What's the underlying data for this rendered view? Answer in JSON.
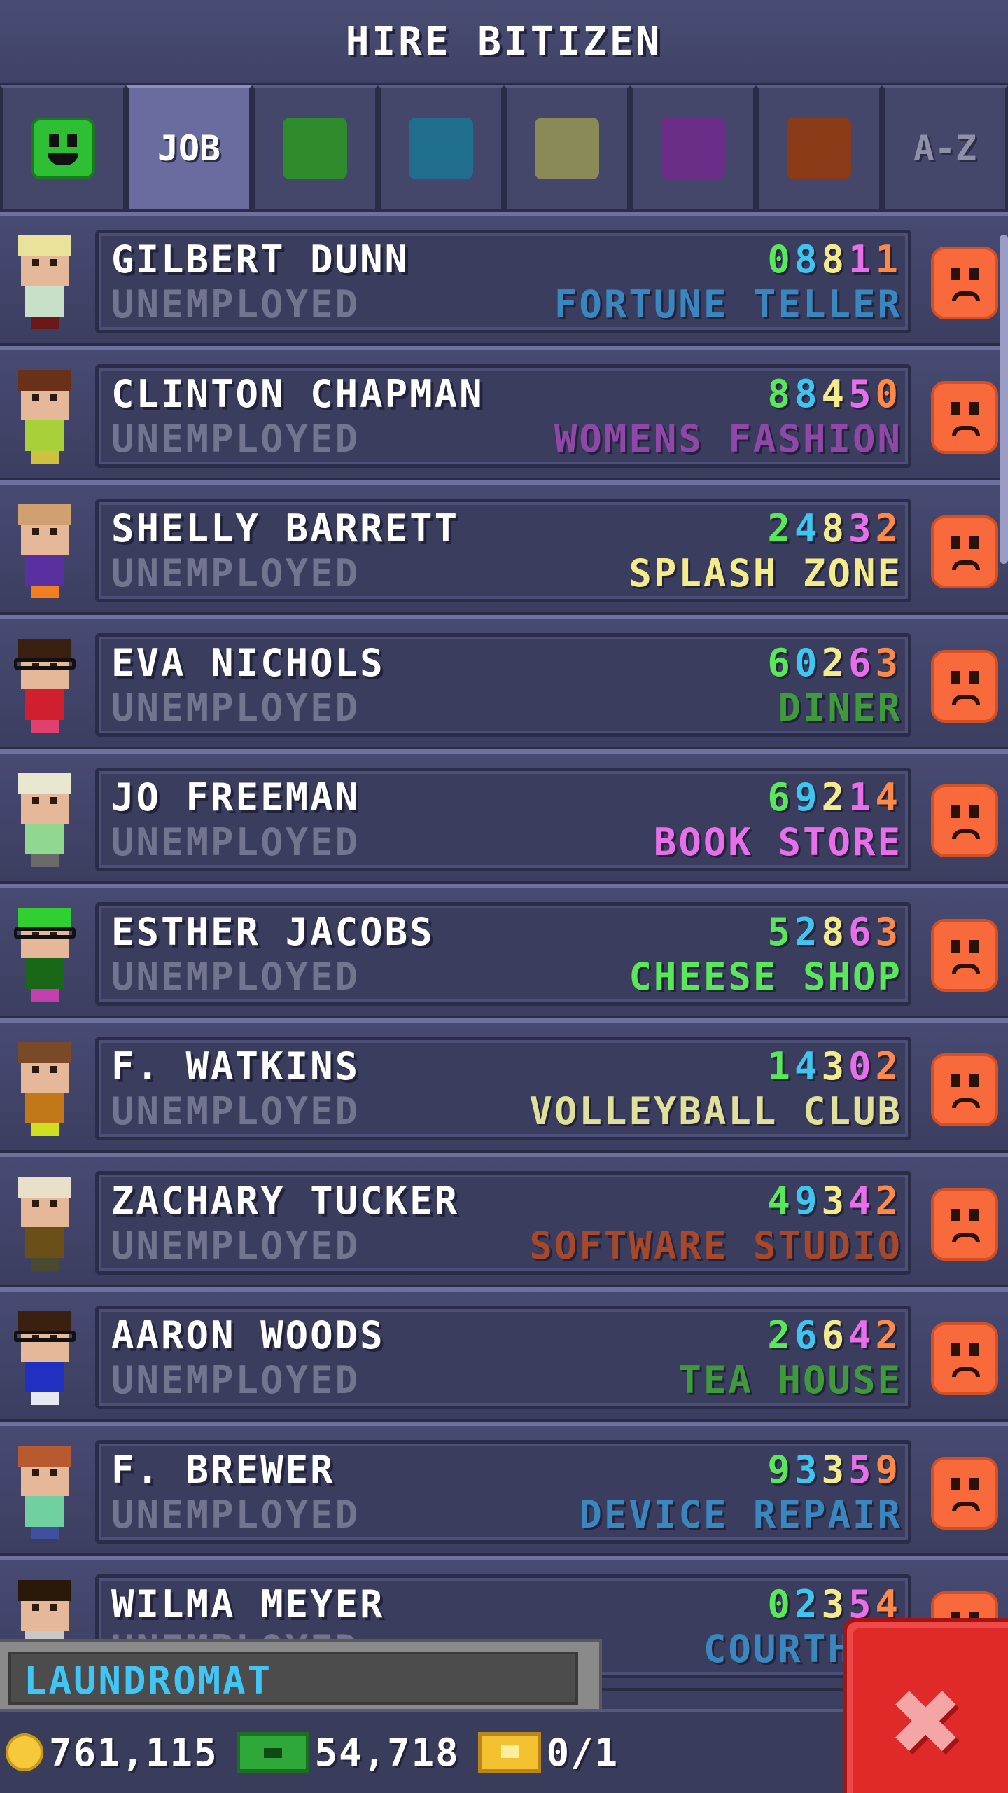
{
  "header": {
    "title": "HIRE BITIZEN"
  },
  "tabs": [
    {
      "kind": "icon",
      "icon": "happy-face-icon",
      "color": "#2fbf35"
    },
    {
      "kind": "text",
      "label": "JOB",
      "active": true
    },
    {
      "kind": "swatch",
      "color": "#2e8a2a"
    },
    {
      "kind": "swatch",
      "color": "#1f6e8e"
    },
    {
      "kind": "swatch",
      "color": "#8a8a58"
    },
    {
      "kind": "swatch",
      "color": "#6c2d88"
    },
    {
      "kind": "swatch",
      "color": "#8a3c18"
    },
    {
      "kind": "text",
      "label": "A-Z"
    }
  ],
  "bitizens": [
    {
      "name": "GILBERT DUNN",
      "status": "UNEMPLOYED",
      "skills": [
        "0",
        "8",
        "8",
        "1",
        "1"
      ],
      "dream_job": "FORTUNE TELLER",
      "dream_color": "#3a86bf",
      "hair": "#e8e29a",
      "shirt": "#c8e0c8",
      "legs": "#6a1818"
    },
    {
      "name": "CLINTON CHAPMAN",
      "status": "UNEMPLOYED",
      "skills": [
        "8",
        "8",
        "4",
        "5",
        "0"
      ],
      "dream_job": "WOMENS FASHION",
      "dream_color": "#9048a8",
      "hair": "#6a3018",
      "shirt": "#a8d038",
      "legs": "#d0c040"
    },
    {
      "name": "SHELLY BARRETT",
      "status": "UNEMPLOYED",
      "skills": [
        "2",
        "4",
        "8",
        "3",
        "2"
      ],
      "dream_job": "SPLASH ZONE",
      "dream_color": "#f4ec8a",
      "hair": "#d0a070",
      "shirt": "#5a30a0",
      "legs": "#f08020"
    },
    {
      "name": "EVA NICHOLS",
      "status": "UNEMPLOYED",
      "skills": [
        "6",
        "0",
        "2",
        "6",
        "3"
      ],
      "dream_job": "DINER",
      "dream_color": "#3e9a3a",
      "hair": "#3a2010",
      "shirt": "#d02030",
      "legs": "#e04070"
    },
    {
      "name": "JO FREEMAN",
      "status": "UNEMPLOYED",
      "skills": [
        "6",
        "9",
        "2",
        "1",
        "4"
      ],
      "dream_job": "BOOK STORE",
      "dream_color": "#e86fea",
      "hair": "#e8e8d0",
      "shirt": "#90d890",
      "legs": "#6a6a6a"
    },
    {
      "name": "ESTHER JACOBS",
      "status": "UNEMPLOYED",
      "skills": [
        "5",
        "2",
        "8",
        "6",
        "3"
      ],
      "dream_job": "CHEESE SHOP",
      "dream_color": "#58e85a",
      "hair": "#30d030",
      "shirt": "#186818",
      "legs": "#c040b0"
    },
    {
      "name": "F. WATKINS",
      "status": "UNEMPLOYED",
      "skills": [
        "1",
        "4",
        "3",
        "0",
        "2"
      ],
      "dream_job": "VOLLEYBALL CLUB",
      "dream_color": "#e0e09a",
      "hair": "#7a4a28",
      "shirt": "#c07818",
      "legs": "#d0e020"
    },
    {
      "name": "ZACHARY TUCKER",
      "status": "UNEMPLOYED",
      "skills": [
        "4",
        "9",
        "3",
        "4",
        "2"
      ],
      "dream_job": "SOFTWARE STUDIO",
      "dream_color": "#a8482a",
      "hair": "#e8e0c8",
      "shirt": "#6a5018",
      "legs": "#4a4a30"
    },
    {
      "name": "AARON WOODS",
      "status": "UNEMPLOYED",
      "skills": [
        "2",
        "6",
        "6",
        "4",
        "2"
      ],
      "dream_job": "TEA HOUSE",
      "dream_color": "#3e9a3a",
      "hair": "#3a2010",
      "shirt": "#2030c0",
      "legs": "#e8e8f0"
    },
    {
      "name": "F. BREWER",
      "status": "UNEMPLOYED",
      "skills": [
        "9",
        "3",
        "3",
        "5",
        "9"
      ],
      "dream_job": "DEVICE REPAIR",
      "dream_color": "#3a86bf",
      "hair": "#b85a30",
      "shirt": "#70d0a0",
      "legs": "#4050a0"
    },
    {
      "name": "WILMA MEYER",
      "status": "UNEMPLOYED",
      "skills": [
        "0",
        "2",
        "3",
        "5",
        "4"
      ],
      "dream_job": "COURTHOU",
      "dream_color": "#3a86bf",
      "hair": "#2a1808",
      "shirt": "#c8c8c8",
      "legs": "#404040"
    }
  ],
  "location": {
    "label": "LAUNDROMAT"
  },
  "footer": {
    "coins": "761,115",
    "bux": "54,718",
    "tickets": "0/1"
  },
  "close": {
    "icon": "close-x-icon"
  }
}
